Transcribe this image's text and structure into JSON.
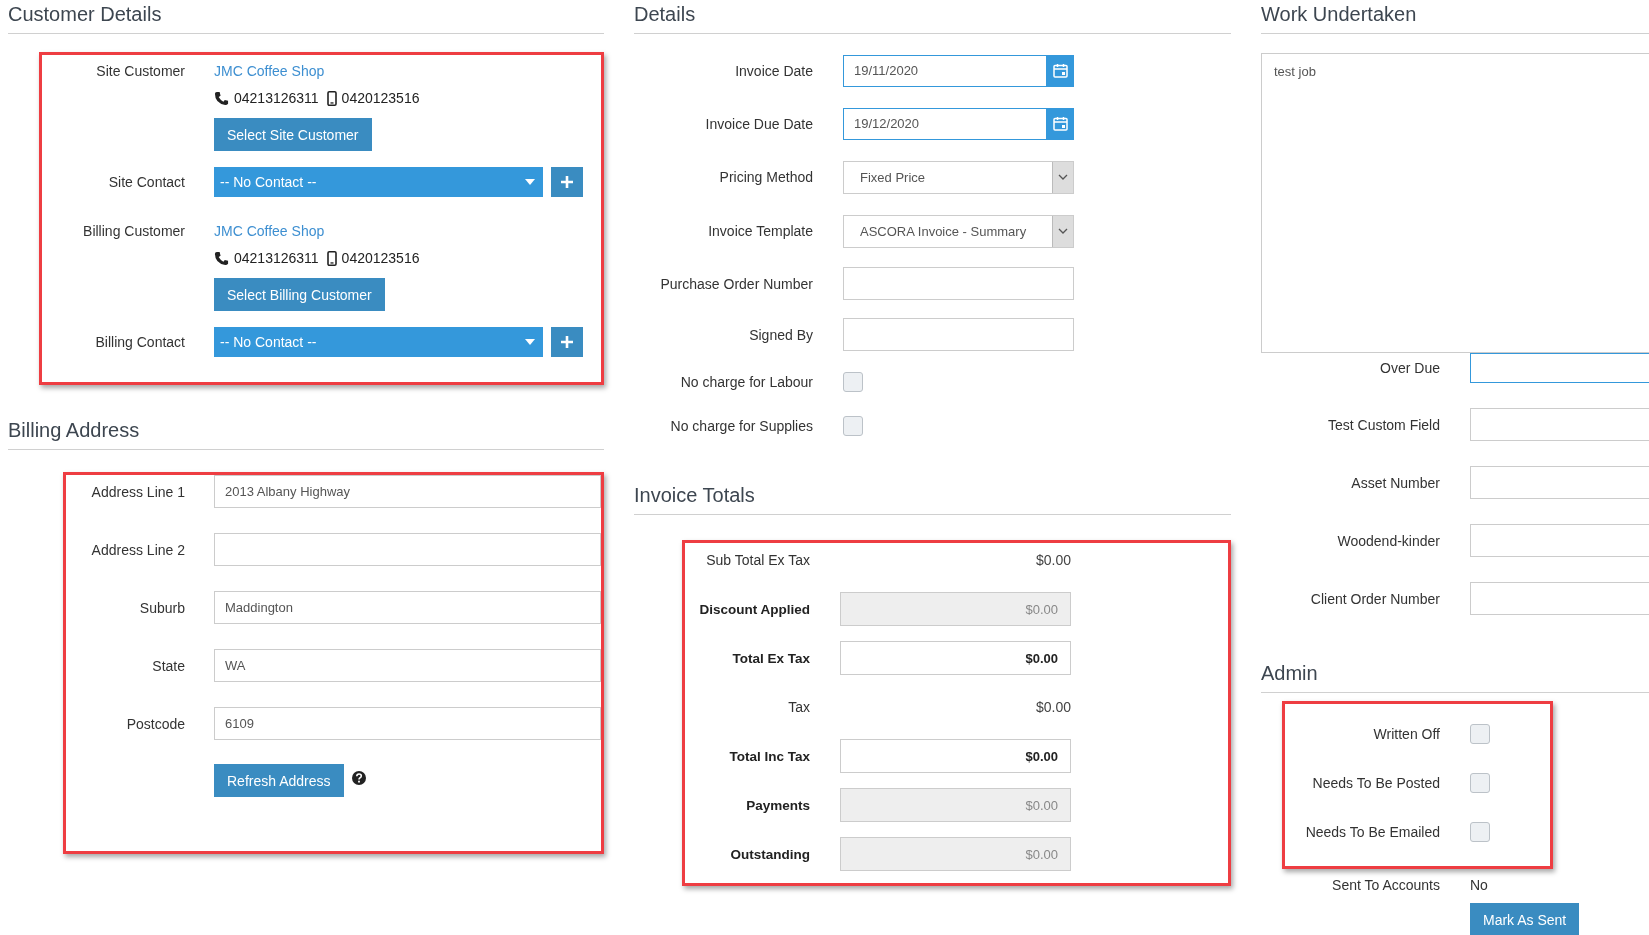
{
  "customer_details": {
    "title": "Customer Details",
    "highlighted": true,
    "rows": [
      {
        "kind": "customer",
        "label": "Site Customer",
        "name": "JMC Coffee Shop",
        "phone": "04213126311",
        "mobile": "0420123516",
        "button": "Select Site Customer"
      },
      {
        "kind": "contact",
        "label": "Site Contact",
        "value": "-- No Contact --"
      },
      {
        "kind": "customer",
        "label": "Billing Customer",
        "name": "JMC Coffee Shop",
        "phone": "04213126311",
        "mobile": "0420123516",
        "button": "Select Billing Customer"
      },
      {
        "kind": "contact",
        "label": "Billing Contact",
        "value": "-- No Contact --"
      }
    ]
  },
  "billing_address": {
    "title": "Billing Address",
    "highlighted": true,
    "rows": [
      {
        "label": "Address Line 1",
        "value": "2013 Albany Highway"
      },
      {
        "label": "Address Line 2"
      },
      {
        "label": "Suburb",
        "value": "Maddington"
      },
      {
        "label": "State",
        "value": "WA"
      },
      {
        "label": "Postcode",
        "value": "6109"
      }
    ],
    "button": "Refresh Address"
  },
  "details": {
    "title": "Details",
    "rows": [
      {
        "kind": "date",
        "label": "Invoice Date",
        "value": "19/11/2020"
      },
      {
        "kind": "date",
        "label": "Invoice Due Date",
        "value": "19/12/2020"
      },
      {
        "kind": "select",
        "label": "Pricing Method",
        "value": "Fixed Price"
      },
      {
        "kind": "select",
        "label": "Invoice Template",
        "value": "ASCORA Invoice - Summary"
      },
      {
        "kind": "text",
        "label": "Purchase Order Number"
      },
      {
        "kind": "text",
        "label": "Signed By"
      },
      {
        "kind": "checkbox",
        "label": "No charge for Labour",
        "checked": false
      },
      {
        "kind": "checkbox",
        "label": "No charge for Supplies",
        "checked": false
      }
    ]
  },
  "invoice_totals": {
    "title": "Invoice Totals",
    "highlighted": true,
    "rows": [
      {
        "kind": "plain",
        "label": "Sub Total Ex Tax",
        "value": "$0.00"
      },
      {
        "kind": "readonly",
        "label": "Discount Applied",
        "value": "$0.00"
      },
      {
        "kind": "total",
        "label": "Total Ex Tax",
        "value": "$0.00"
      },
      {
        "kind": "plain",
        "label": "Tax",
        "value": "$0.00"
      },
      {
        "kind": "total",
        "label": "Total Inc Tax",
        "value": "$0.00"
      },
      {
        "kind": "readonly",
        "label": "Payments",
        "value": "$0.00"
      },
      {
        "kind": "readonly",
        "label": "Outstanding",
        "value": "$0.00"
      }
    ]
  },
  "work_undertaken": {
    "title": "Work Undertaken",
    "text": "test job",
    "fields": [
      {
        "label": "Over Due",
        "focused": true
      },
      {
        "label": "Test Custom Field",
        "focused": false
      },
      {
        "label": "Asset Number",
        "focused": false
      },
      {
        "label": "Woodend-kinder",
        "focused": false
      },
      {
        "label": "Client Order Number",
        "focused": false
      }
    ]
  },
  "admin": {
    "title": "Admin",
    "highlighted": true,
    "rows": [
      {
        "label": "Written Off",
        "checked": false
      },
      {
        "label": "Needs To Be Posted",
        "checked": false
      },
      {
        "label": "Needs To Be Emailed",
        "checked": false
      }
    ],
    "sent_to_accounts": {
      "label": "Sent To Accounts",
      "value": "No"
    },
    "button": "Mark As Sent"
  }
}
